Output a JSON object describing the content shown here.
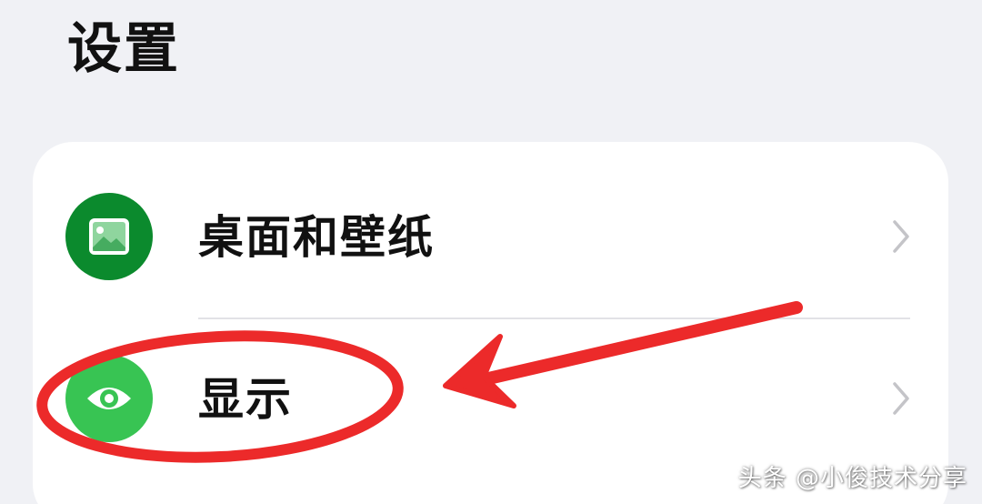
{
  "header": {
    "title": "设置"
  },
  "settings_list": {
    "items": [
      {
        "label": "桌面和壁纸",
        "icon": "wallpaper-icon",
        "icon_color": "#0b8a2d"
      },
      {
        "label": "显示",
        "icon": "eye-icon",
        "icon_color": "#38c453"
      }
    ]
  },
  "annotation": {
    "color": "#ec2a2a",
    "highlighted_item": "显示"
  },
  "watermark": {
    "text": "头条 @小俊技术分享"
  }
}
